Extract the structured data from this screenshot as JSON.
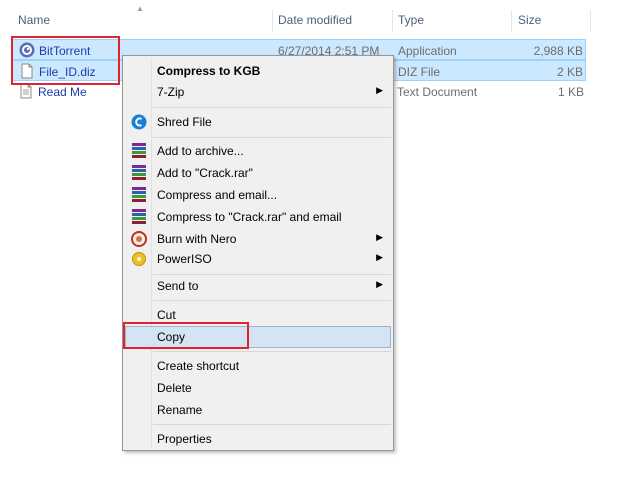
{
  "header": {
    "name": "Name",
    "date_modified": "Date modified",
    "type": "Type",
    "size": "Size"
  },
  "files": [
    {
      "name": "BitTorrent",
      "date": "6/27/2014 2:51 PM",
      "type": "Application",
      "size": "2,988 KB",
      "icon": "bittorrent-icon",
      "selected": true
    },
    {
      "name": "File_ID.diz",
      "date": "",
      "type": "DIZ File",
      "size": "2 KB",
      "icon": "text-file-icon",
      "selected": true
    },
    {
      "name": "Read Me",
      "date": "",
      "type": "Text Document",
      "size": "1 KB",
      "icon": "text-file-icon",
      "selected": false
    }
  ],
  "menu": {
    "compress_kgb": "Compress to KGB",
    "seven_zip": "7-Zip",
    "shred_file": "Shred File",
    "add_to_archive": "Add to archive...",
    "add_to_crack": "Add to \"Crack.rar\"",
    "compress_email": "Compress and email...",
    "compress_crack_email": "Compress to \"Crack.rar\" and email",
    "burn_nero": "Burn with Nero",
    "poweriso": "PowerISO",
    "send_to": "Send to",
    "cut": "Cut",
    "copy": "Copy",
    "create_shortcut": "Create shortcut",
    "delete": "Delete",
    "rename": "Rename",
    "properties": "Properties"
  },
  "colors": {
    "selection": "#cce8ff",
    "highlight_box": "#e0232e",
    "link_text": "#1a3cb0"
  }
}
